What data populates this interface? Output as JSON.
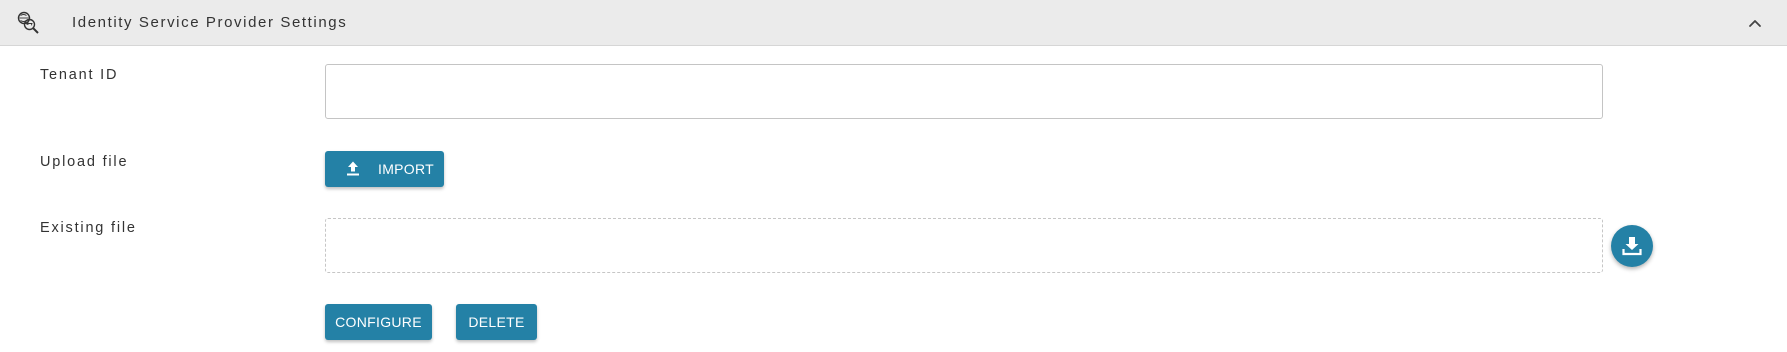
{
  "header": {
    "title": "Identity Service Provider Settings",
    "icon": "key-search-icon",
    "collapse_icon": "chevron-up-icon"
  },
  "form": {
    "tenant_id": {
      "label": "Tenant ID",
      "value": "",
      "placeholder": ""
    },
    "upload": {
      "label": "Upload file",
      "button_label": "IMPORT",
      "button_icon": "upload-icon"
    },
    "existing": {
      "label": "Existing file",
      "value": "",
      "download_icon": "download-icon"
    }
  },
  "actions": {
    "configure_label": "CONFIGURE",
    "delete_label": "DELETE"
  },
  "colors": {
    "primary": "#2481a6",
    "header_bg": "#ebebeb",
    "border": "#c4c4c4"
  }
}
